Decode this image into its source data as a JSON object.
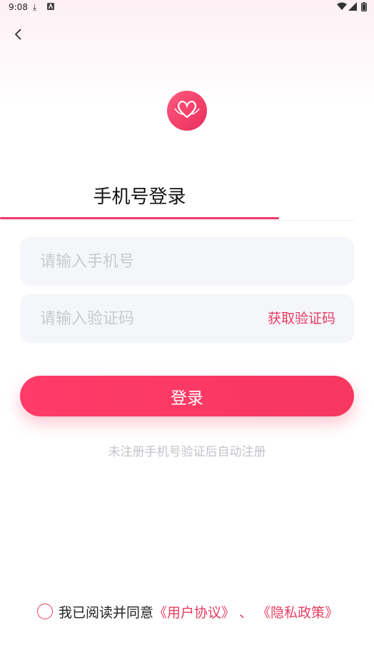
{
  "status_bar": {
    "time": "9:08",
    "icons": [
      "download-icon",
      "a-notification-icon",
      "wifi-icon",
      "signal-icon",
      "battery-icon"
    ]
  },
  "nav": {
    "back_icon": "chevron-left-icon"
  },
  "logo": {
    "icon": "swan-heart-logo",
    "color": "#e92d5c"
  },
  "login": {
    "title": "手机号登录",
    "phone_placeholder": "请输入手机号",
    "phone_value": "",
    "code_placeholder": "请输入验证码",
    "code_value": "",
    "get_code_label": "获取验证码",
    "submit_label": "登录",
    "hint": "未注册手机号验证后自动注册"
  },
  "agreement": {
    "checked": false,
    "prefix": "我已阅读并同意",
    "user_agreement": "《用户协议》",
    "separator": "、",
    "privacy_policy": "《隐私政策》"
  },
  "colors": {
    "accent": "#ec3b66",
    "field_bg": "#f5f6fa"
  }
}
